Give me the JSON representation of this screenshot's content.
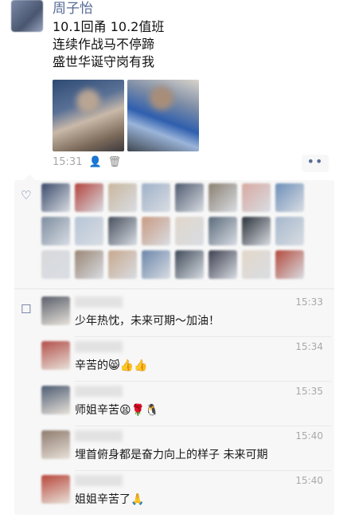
{
  "post": {
    "author": "周子怡",
    "text": "10.1回甬 10.2值班\n连续作战马不停蹄\n盛世华诞守岗有我",
    "time": "15:31",
    "icons": {
      "privacy": "person-icon",
      "delete": "trash-icon",
      "more": "more-dots-icon"
    },
    "more_label": "••"
  },
  "likes": {
    "icon": "heart-icon",
    "glyph": "♡",
    "avatar_colors": [
      "#3a4a6a",
      "#b3433c",
      "#c9b79d",
      "#9fb1c8",
      "#4e5a6f",
      "#8a7f70",
      "#d7a9a0",
      "#6d8fb8",
      "#7d8da0",
      "#b6c5d6",
      "#47505e",
      "#c99a82",
      "#e0d6cb",
      "#5b6b7c",
      "#2b313b",
      "#a6b8cc",
      "#d8d9dc",
      "#9a8674",
      "#c7a88c",
      "#6b86aa",
      "#3f4a59",
      "#3c3f4f",
      "#e3d7c9",
      "#b44a3c"
    ]
  },
  "comments": {
    "icon": "comment-icon",
    "glyph": "☐",
    "items": [
      {
        "time": "15:33",
        "text": "少年热忱，未来可期～加油！",
        "avatar_color": "#5a5f6b"
      },
      {
        "time": "15:34",
        "text": "辛苦的😸👍👍",
        "avatar_color": "#b34f4a"
      },
      {
        "time": "15:35",
        "text": "师姐辛苦😫🌹🐧",
        "avatar_color": "#4d5c72"
      },
      {
        "time": "15:40",
        "text": "埋首俯身都是奋力向上的样子 未来可期",
        "avatar_color": "#8e7a6d"
      },
      {
        "time": "15:40",
        "text": "姐姐辛苦了🙏",
        "avatar_color": "#b8463a"
      }
    ]
  }
}
